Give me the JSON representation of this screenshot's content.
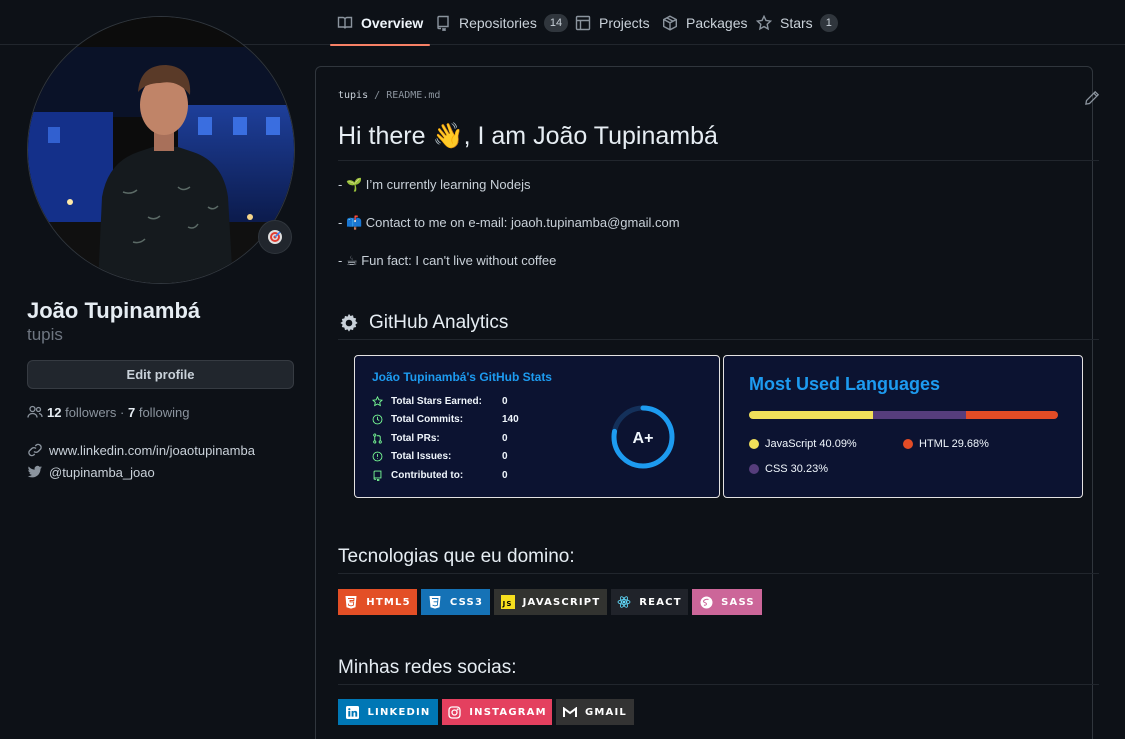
{
  "nav": {
    "tabs": [
      {
        "label": "Overview",
        "count": null,
        "icon": "book-icon"
      },
      {
        "label": "Repositories",
        "count": "14",
        "icon": "repo-icon"
      },
      {
        "label": "Projects",
        "count": null,
        "icon": "table-icon"
      },
      {
        "label": "Packages",
        "count": null,
        "icon": "package-icon"
      },
      {
        "label": "Stars",
        "count": "1",
        "icon": "star-icon"
      }
    ],
    "active_tab": "Overview"
  },
  "profile": {
    "name": "João Tupinambá",
    "login": "tupis",
    "edit_label": "Edit profile",
    "followers_count": "12",
    "followers_label": "followers",
    "separator": "·",
    "following_count": "7",
    "following_label": "following",
    "website": "www.linkedin.com/in/joaotupinamba",
    "twitter": "@tupinamba_joao"
  },
  "readme": {
    "path_user": "tupis",
    "path_sep": "/",
    "path_file": "README.md",
    "heading": "Hi there 👋, I am João Tupinambá",
    "lines": [
      "- 🌱 I’m currently learning Nodejs",
      "- 📫 Contact to me on e-mail: joaoh.tupinamba@gmail.com",
      "- ☕ Fun fact: I can't live without coffee"
    ],
    "analytics_heading": "GitHub Analytics",
    "tech_heading": "Tecnologias que eu domino:",
    "social_heading": "Minhas redes socias:"
  },
  "stats_card": {
    "title": "João Tupinambá's GitHub Stats",
    "rows": [
      {
        "label": "Total Stars Earned:",
        "value": "0",
        "icon": "star-icon"
      },
      {
        "label": "Total Commits:",
        "value": "140",
        "icon": "clock-icon"
      },
      {
        "label": "Total PRs:",
        "value": "0",
        "icon": "pull-request-icon"
      },
      {
        "label": "Total Issues:",
        "value": "0",
        "icon": "issue-icon"
      },
      {
        "label": "Contributed to:",
        "value": "0",
        "icon": "repo-icon"
      }
    ],
    "rank": "A+",
    "rank_progress": 0.78
  },
  "lang_card": {
    "title": "Most Used Languages",
    "languages": [
      {
        "name": "JavaScript",
        "percent": 40.09,
        "label": "JavaScript 40.09%",
        "color": "#f1e05a"
      },
      {
        "name": "CSS",
        "percent": 30.23,
        "label": "CSS 30.23%",
        "color": "#563d7c"
      },
      {
        "name": "HTML",
        "percent": 29.68,
        "label": "HTML 29.68%",
        "color": "#e34c26"
      }
    ]
  },
  "tech_badges": [
    {
      "label": "HTML5",
      "color": "#e34f26",
      "icon": "html5-icon"
    },
    {
      "label": "CSS3",
      "color": "#1572b6",
      "icon": "css3-icon"
    },
    {
      "label": "JAVASCRIPT",
      "color": "#323330",
      "icon": "javascript-icon"
    },
    {
      "label": "REACT",
      "color": "#20232a",
      "icon": "react-icon"
    },
    {
      "label": "SASS",
      "color": "#cc6699",
      "icon": "sass-icon"
    }
  ],
  "social_badges": [
    {
      "label": "LINKEDIN",
      "color": "#0077b5",
      "icon": "linkedin-icon"
    },
    {
      "label": "INSTAGRAM",
      "color": "#e4405f",
      "icon": "instagram-icon"
    },
    {
      "label": "GMAIL",
      "color": "#333333",
      "icon": "gmail-icon"
    }
  ]
}
